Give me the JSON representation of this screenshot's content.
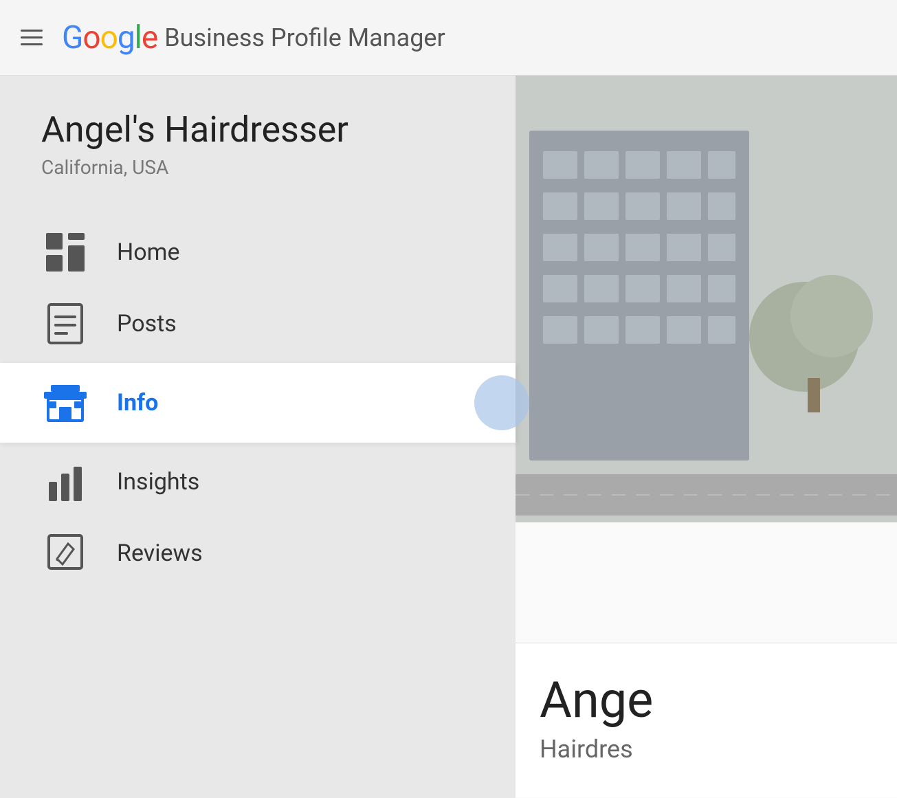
{
  "header": {
    "menu_icon_label": "Menu",
    "google_text": "Google",
    "title": "Business Profile Manager"
  },
  "business": {
    "name": "Angel's Hairdresser",
    "location": "California, USA",
    "type": "Hairdres"
  },
  "nav": {
    "home_label": "Home",
    "posts_label": "Posts",
    "info_label": "Info",
    "insights_label": "Insights",
    "reviews_label": "Reviews"
  },
  "overlay": {
    "name_start": "Ange",
    "type": "Hairdres"
  },
  "colors": {
    "selected_blue": "#1a73e8",
    "google_blue": "#4285F4",
    "google_red": "#EA4335",
    "google_yellow": "#FBBC05",
    "google_green": "#34A853",
    "sidebar_bg": "#e8e8e8",
    "header_bg": "#f5f5f5",
    "selected_row_bg": "#ffffff"
  }
}
